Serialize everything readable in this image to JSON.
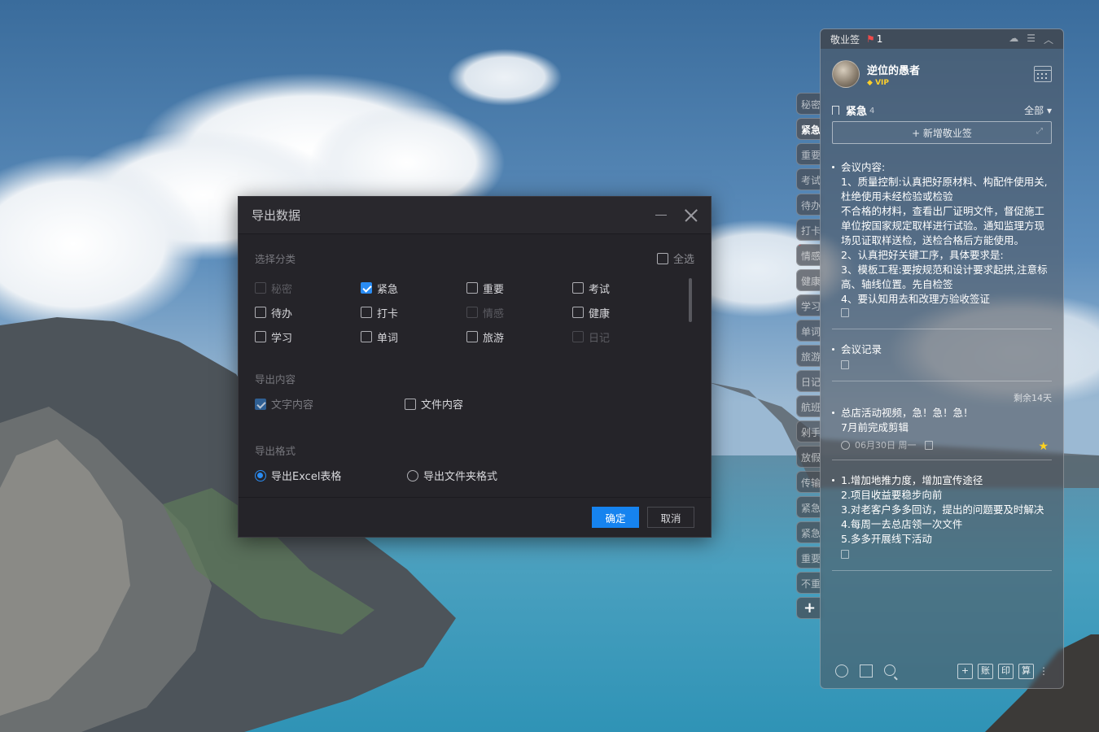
{
  "theme": {
    "accent": "#1683EF",
    "dialog_bg": "#252429",
    "star": "#FFD21E",
    "alert": "#F04A4A"
  },
  "side_tabs": [
    {
      "label": "秘密",
      "active": false
    },
    {
      "label": "紧急",
      "active": true
    },
    {
      "label": "重要",
      "active": false
    },
    {
      "label": "考试",
      "active": false
    },
    {
      "label": "待办",
      "active": false
    },
    {
      "label": "打卡",
      "active": false
    },
    {
      "label": "情感",
      "active": false,
      "dot": true
    },
    {
      "label": "健康",
      "active": false
    },
    {
      "label": "学习",
      "active": false
    },
    {
      "label": "单词",
      "active": false
    },
    {
      "label": "旅游",
      "active": false
    },
    {
      "label": "日记",
      "active": false
    },
    {
      "label": "航班",
      "active": false
    },
    {
      "label": "剁手",
      "active": false
    },
    {
      "label": "放假",
      "active": false
    },
    {
      "label": "传输",
      "active": false
    },
    {
      "label": "紧急",
      "active": false
    },
    {
      "label": "紧急",
      "active": false
    },
    {
      "label": "重要",
      "active": false
    },
    {
      "label": "不重",
      "active": false
    }
  ],
  "side_add": "+",
  "panel": {
    "app_name": "敬业签",
    "notify_count": "1",
    "icons": [
      "cloud-icon",
      "menu-icon",
      "collapse-icon"
    ],
    "user": {
      "name": "逆位的愚者",
      "badge": "VIP"
    },
    "category": {
      "name": "紧急",
      "count": "4",
      "filter": "全部"
    },
    "new_note": "+ 新增敬业签",
    "notes": [
      {
        "text": "会议内容:\n1、质量控制:认真把好原材料、构配件使用关,杜绝使用未经检验或检验\n不合格的材料，查看出厂证明文件，督促施工单位按国家规定取样进行试验。通知监理方现场见证取样送检，送检合格后方能使用。\n2、认真把好关键工序，具体要求是:\n3、模板工程:要按规范和设计要求起拱,注意标高、轴线位置。先自检签\n4、要认知用去和改理方验收签证"
      },
      {
        "text": "会议记录"
      },
      {
        "text": "总店活动视频，急！急！急！\n7月前完成剪辑",
        "remaining": "剩余14天",
        "date": "06月30日 周一",
        "starred": true
      },
      {
        "text": "1.增加地推力度，增加宣传途径\n2.项目收益要稳步向前\n3.对老客户多多回访，提出的问题要及时解决\n4.每周一去总店领一次文件\n5.多多开展线下活动"
      }
    ],
    "footer": {
      "buttons": [
        "+",
        "账",
        "印",
        "算"
      ],
      "more": "⋮"
    }
  },
  "dialog": {
    "title": "导出数据",
    "section_category": "选择分类",
    "select_all": "全选",
    "categories": [
      [
        {
          "label": "秘密",
          "checked": false,
          "disabled": true
        },
        {
          "label": "紧急",
          "checked": true,
          "disabled": false
        },
        {
          "label": "重要",
          "checked": false,
          "disabled": false
        },
        {
          "label": "考试",
          "checked": false,
          "disabled": false
        }
      ],
      [
        {
          "label": "待办",
          "checked": false,
          "disabled": false
        },
        {
          "label": "打卡",
          "checked": false,
          "disabled": false
        },
        {
          "label": "情感",
          "checked": false,
          "disabled": true
        },
        {
          "label": "健康",
          "checked": false,
          "disabled": false
        }
      ],
      [
        {
          "label": "学习",
          "checked": false,
          "disabled": false
        },
        {
          "label": "单词",
          "checked": false,
          "disabled": false
        },
        {
          "label": "旅游",
          "checked": false,
          "disabled": false
        },
        {
          "label": "日记",
          "checked": false,
          "disabled": true
        }
      ]
    ],
    "section_content": "导出内容",
    "content_text": "文字内容",
    "content_files": "文件内容",
    "section_format": "导出格式",
    "format_excel": "导出Excel表格",
    "format_folder": "导出文件夹格式",
    "ok": "确定",
    "cancel": "取消"
  }
}
